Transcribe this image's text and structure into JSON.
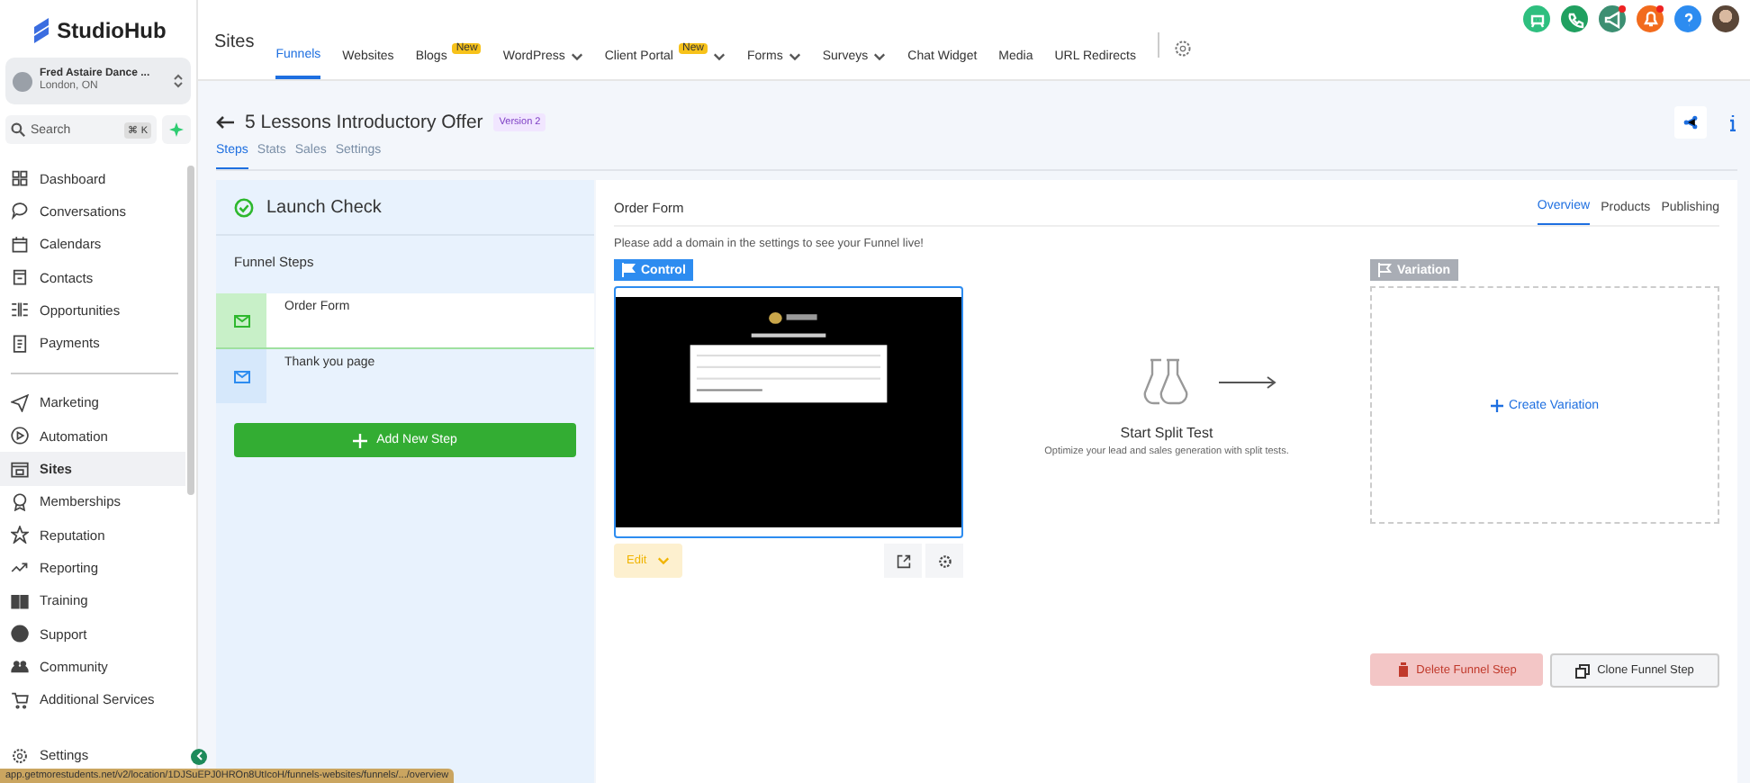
{
  "sidebar": {
    "logo": "StudioHub",
    "account": {
      "name": "Fred Astaire Dance ...",
      "location": "London, ON"
    },
    "search": {
      "placeholder": "Search",
      "shortcut": "⌘ K"
    },
    "groups": [
      [
        {
          "label": "Dashboard",
          "selected": false
        },
        {
          "label": "Conversations",
          "selected": false
        },
        {
          "label": "Calendars",
          "selected": false
        },
        {
          "label": "Contacts",
          "selected": false
        },
        {
          "label": "Opportunities",
          "selected": false
        },
        {
          "label": "Payments",
          "selected": false
        }
      ],
      [
        {
          "label": "Marketing",
          "selected": false
        },
        {
          "label": "Automation",
          "selected": false
        },
        {
          "label": "Sites",
          "selected": true
        },
        {
          "label": "Memberships",
          "selected": false
        },
        {
          "label": "Reputation",
          "selected": false
        },
        {
          "label": "Reporting",
          "selected": false
        },
        {
          "label": "Training",
          "selected": false
        },
        {
          "label": "Support",
          "selected": false
        },
        {
          "label": "Community",
          "selected": false
        },
        {
          "label": "Additional Services",
          "selected": false
        }
      ]
    ],
    "settings": "Settings"
  },
  "topbar": {
    "title": "Sites",
    "tabs": [
      {
        "label": "Funnels",
        "selected": true,
        "dropdown": false
      },
      {
        "label": "Websites",
        "selected": false,
        "dropdown": false
      },
      {
        "label": "Blogs",
        "selected": false,
        "dropdown": false,
        "badge": "New"
      },
      {
        "label": "WordPress",
        "selected": false,
        "dropdown": true
      },
      {
        "label": "Client Portal",
        "selected": false,
        "dropdown": true,
        "badge": "New"
      },
      {
        "label": "Forms",
        "selected": false,
        "dropdown": true
      },
      {
        "label": "Surveys",
        "selected": false,
        "dropdown": true
      },
      {
        "label": "Chat Widget",
        "selected": false,
        "dropdown": false
      },
      {
        "label": "Media",
        "selected": false,
        "dropdown": false
      },
      {
        "label": "URL Redirects",
        "selected": false,
        "dropdown": false
      }
    ],
    "actions": [
      {
        "color": "#2ebf7f",
        "dot": false
      },
      {
        "color": "#20a060",
        "dot": false
      },
      {
        "color": "#3c8f72",
        "dot": true
      },
      {
        "color": "#f26b1d",
        "dot": true
      },
      {
        "color": "#2d8cf0",
        "dot": false
      }
    ]
  },
  "page": {
    "title": "5 Lessons Introductory Offer",
    "version": "Version 2",
    "tabs": [
      {
        "label": "Steps",
        "selected": true
      },
      {
        "label": "Stats",
        "selected": false
      },
      {
        "label": "Sales",
        "selected": false
      },
      {
        "label": "Settings",
        "selected": false
      }
    ]
  },
  "steps_panel": {
    "header": "Launch Check",
    "subheader": "Funnel Steps",
    "steps": [
      {
        "name": "Order Form",
        "selected": true
      },
      {
        "name": "Thank you page",
        "selected": false
      }
    ],
    "add_button": "Add New Step"
  },
  "step_detail": {
    "title": "Order Form",
    "tabs": [
      {
        "label": "Overview",
        "selected": true
      },
      {
        "label": "Products",
        "selected": false
      },
      {
        "label": "Publishing",
        "selected": false
      }
    ],
    "notice": "Please add a domain in the settings to see your Funnel live!",
    "control": {
      "label": "Control",
      "edit": "Edit"
    },
    "split_test": {
      "title": "Start Split Test",
      "text": "Optimize your lead and sales generation with split tests."
    },
    "variation": {
      "label": "Variation",
      "action": "Create Variation"
    },
    "delete_button": "Delete Funnel Step",
    "clone_button": "Clone Funnel Step"
  },
  "status_url": "app.getmorestudents.net/v2/location/1DJSuEPJ0HROn8UtIcoH/funnels-websites/funnels/.../overview"
}
